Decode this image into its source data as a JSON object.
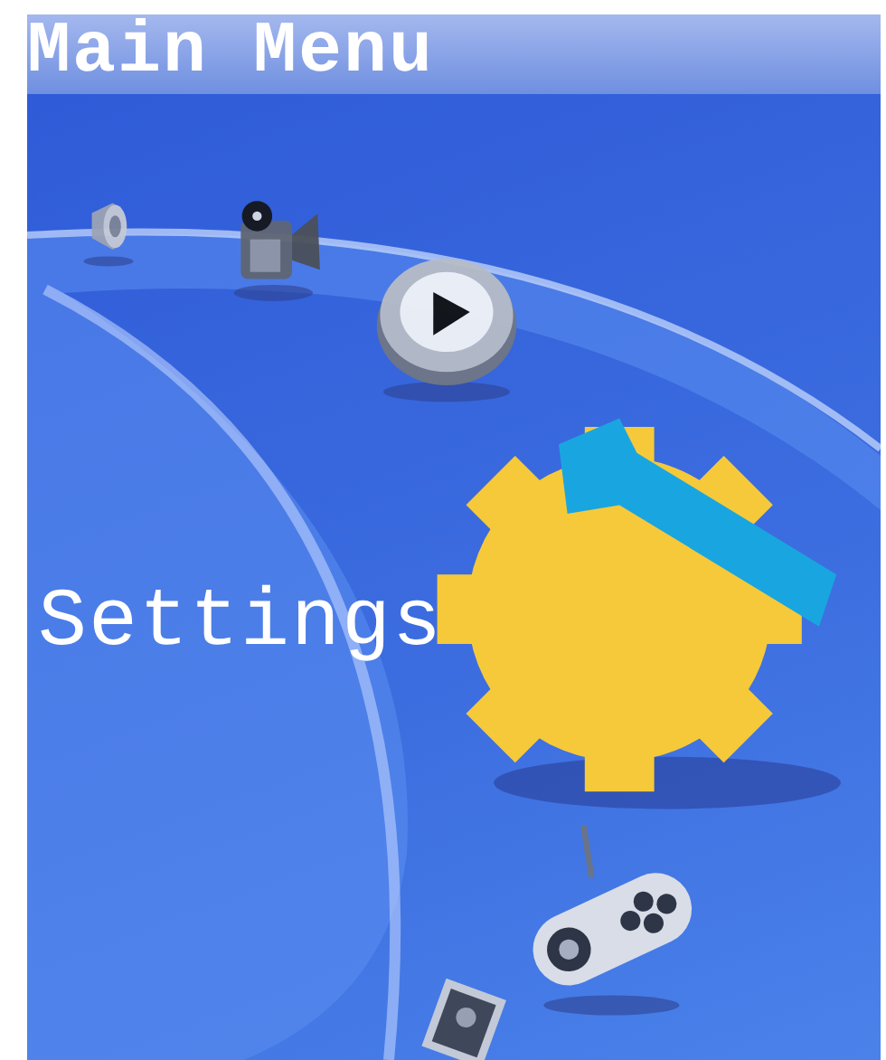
{
  "header": {
    "title": "Main Menu"
  },
  "menu": {
    "items": [
      {
        "kind": "speaker",
        "selected": false
      },
      {
        "kind": "camera",
        "selected": false
      },
      {
        "kind": "player",
        "selected": false
      },
      {
        "kind": "settings",
        "selected": true
      },
      {
        "kind": "gamepad",
        "selected": false
      },
      {
        "kind": "picture",
        "selected": false
      }
    ],
    "selected_label": "Settings"
  }
}
